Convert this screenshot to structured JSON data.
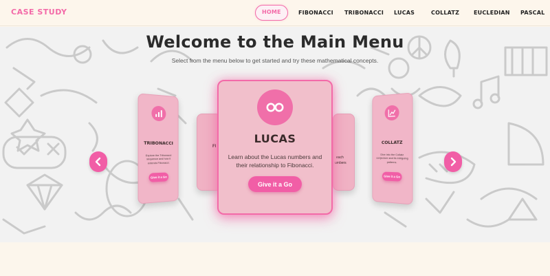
{
  "brand": "CASE STUDY",
  "nav": {
    "items": [
      {
        "label": "HOME",
        "active": true
      },
      {
        "label": "FIBONACCI",
        "active": false
      },
      {
        "label": "TRIBONACCI",
        "active": false
      },
      {
        "label": "LUCAS",
        "active": false
      },
      {
        "label": "COLLATZ",
        "active": false
      },
      {
        "label": "EUCLEDIAN",
        "active": false
      },
      {
        "label": "PASCAL",
        "active": false
      }
    ]
  },
  "hero": {
    "title": "Welcome to the Main Menu",
    "subtitle": "Select from the menu below to get started and try these mathematical concepts."
  },
  "carousel": {
    "main_card": {
      "icon": "infinity-icon",
      "title": "LUCAS",
      "description": "Learn about the Lucas numbers and their relationship to Fibonacci.",
      "button": "Give it a Go"
    },
    "left_card": {
      "icon": "bar-chart-icon",
      "title": "TRIBONACCI",
      "description": "Explore the Tribonacci sequence and how it extends Fibonacci.",
      "button": "Give it a Go"
    },
    "right_card": {
      "icon": "line-chart-icon",
      "title": "COLLATZ",
      "description": "Dive into the Collatz conjecture and its intriguing patterns.",
      "button": "Give it a Go"
    },
    "back_left_card": {
      "title_fragment": "FI"
    },
    "back_right_card": {
      "text_fragment_1": "each",
      "text_fragment_2": "umbers"
    },
    "prev_label": "‹",
    "next_label": "›"
  },
  "colors": {
    "accent": "#f36aa8",
    "button": "#f15ea6",
    "card": "#f1bfcb",
    "background": "#fcf6ec"
  }
}
